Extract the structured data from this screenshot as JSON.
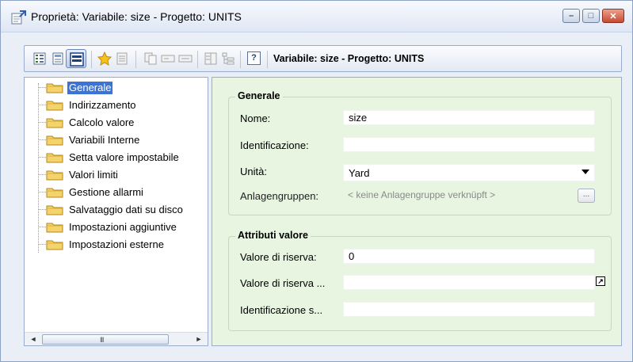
{
  "window": {
    "title": "Proprietà: Variabile: size - Progetto: UNITS",
    "controls": {
      "minimize": "–",
      "maximize": "□",
      "close": "✕"
    }
  },
  "toolbar": {
    "title": "Variabile: size - Progetto: UNITS",
    "help_glyph": "?"
  },
  "tree": {
    "items": [
      {
        "label": "Generale",
        "selected": true
      },
      {
        "label": "Indirizzamento"
      },
      {
        "label": "Calcolo valore"
      },
      {
        "label": "Variabili Interne"
      },
      {
        "label": "Setta valore impostabile"
      },
      {
        "label": "Valori limiti"
      },
      {
        "label": "Gestione allarmi"
      },
      {
        "label": "Salvataggio dati su disco"
      },
      {
        "label": "Impostazioni aggiuntive"
      },
      {
        "label": "Impostazioni esterne"
      }
    ],
    "scroll_left": "◄",
    "scroll_right": "►",
    "scroll_grip": "III"
  },
  "general": {
    "title": "Generale",
    "nome_label": "Nome:",
    "nome_value": "size",
    "identificazione_label": "Identificazione:",
    "identificazione_value": "",
    "unita_label": "Unità:",
    "unita_value": "Yard",
    "anlagen_label": "Anlagengruppen:",
    "anlagen_value": "< keine Anlagengruppe verknüpft >",
    "browse_label": "..."
  },
  "attributes": {
    "title": "Attributi valore",
    "riserva_label": "Valore di riserva:",
    "riserva_value": "0",
    "riserva2_label": "Valore di riserva ...",
    "riserva2_value": "",
    "ident_label": "Identificazione s...",
    "ident_value": "",
    "jump_glyph": "↗"
  }
}
